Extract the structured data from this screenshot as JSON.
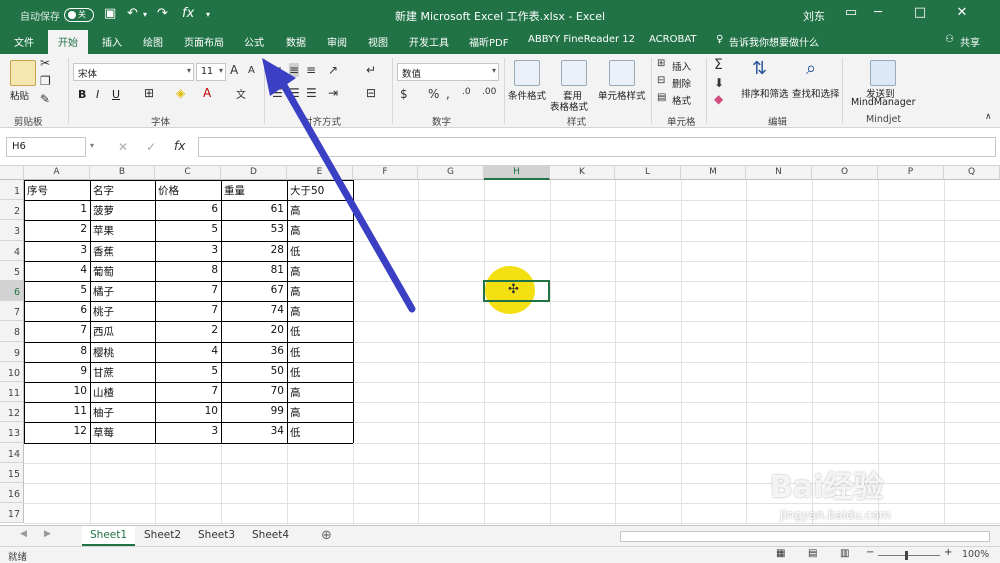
{
  "titlebar": {
    "autosave_label": "自动保存",
    "autosave_state": "关",
    "title": "新建 Microsoft Excel 工作表.xlsx  -  Excel",
    "user": "刘东"
  },
  "tabs": [
    "文件",
    "开始",
    "插入",
    "绘图",
    "页面布局",
    "公式",
    "数据",
    "审阅",
    "视图",
    "开发工具",
    "福昕PDF",
    "ABBYY FineReader 12",
    "ACROBAT"
  ],
  "tell_me": "告诉我你想要做什么",
  "share": "共享",
  "ribbon": {
    "clipboard": {
      "paste": "粘贴",
      "group": "剪贴板"
    },
    "font": {
      "name": "宋体",
      "size": "11",
      "group": "字体",
      "bold": "B",
      "italic": "I",
      "underline": "U"
    },
    "alignment": {
      "group": "对齐方式"
    },
    "number": {
      "format": "数值",
      "group": "数字"
    },
    "styles": {
      "cond": "条件格式",
      "table_l1": "套用",
      "table_l2": "表格格式",
      "cell": "单元格样式",
      "group": "样式"
    },
    "cells": {
      "insert": "插入",
      "delete": "删除",
      "format": "格式",
      "group": "单元格"
    },
    "editing": {
      "sort": "排序和筛选",
      "find": "查找和选择",
      "group": "编辑"
    },
    "mindjet": {
      "send_l1": "发送到",
      "send_l2": "MindManager",
      "group": "Mindjet"
    }
  },
  "formula_bar": {
    "name_box": "H6",
    "formula": ""
  },
  "columns": [
    "A",
    "B",
    "C",
    "D",
    "E",
    "F",
    "G",
    "H",
    "K",
    "L",
    "M",
    "N",
    "O",
    "P",
    "Q"
  ],
  "rows": [
    "1",
    "2",
    "3",
    "4",
    "5",
    "6",
    "7",
    "8",
    "9",
    "10",
    "11",
    "12",
    "13",
    "14",
    "15",
    "16",
    "17"
  ],
  "table": {
    "headers": [
      "序号",
      "名字",
      "价格",
      "重量",
      "大于50"
    ],
    "rows": [
      [
        "1",
        "菠萝",
        "6",
        "61",
        "高"
      ],
      [
        "2",
        "苹果",
        "5",
        "53",
        "高"
      ],
      [
        "3",
        "香蕉",
        "3",
        "28",
        "低"
      ],
      [
        "4",
        "葡萄",
        "8",
        "81",
        "高"
      ],
      [
        "5",
        "橘子",
        "7",
        "67",
        "高"
      ],
      [
        "6",
        "桃子",
        "7",
        "74",
        "高"
      ],
      [
        "7",
        "西瓜",
        "2",
        "20",
        "低"
      ],
      [
        "8",
        "樱桃",
        "4",
        "36",
        "低"
      ],
      [
        "9",
        "甘蔗",
        "5",
        "50",
        "低"
      ],
      [
        "10",
        "山楂",
        "7",
        "70",
        "高"
      ],
      [
        "11",
        "柚子",
        "10",
        "99",
        "高"
      ],
      [
        "12",
        "草莓",
        "3",
        "34",
        "低"
      ]
    ]
  },
  "sheets": [
    "Sheet1",
    "Sheet2",
    "Sheet3",
    "Sheet4"
  ],
  "status": {
    "ready": "就绪",
    "zoom": "100%"
  },
  "watermark": {
    "brand": "Bai经验",
    "url": "jingyan.baidu.com"
  },
  "colors": {
    "accent": "#217346",
    "arrow": "#3a3fc4",
    "halo": "#f4e012"
  }
}
